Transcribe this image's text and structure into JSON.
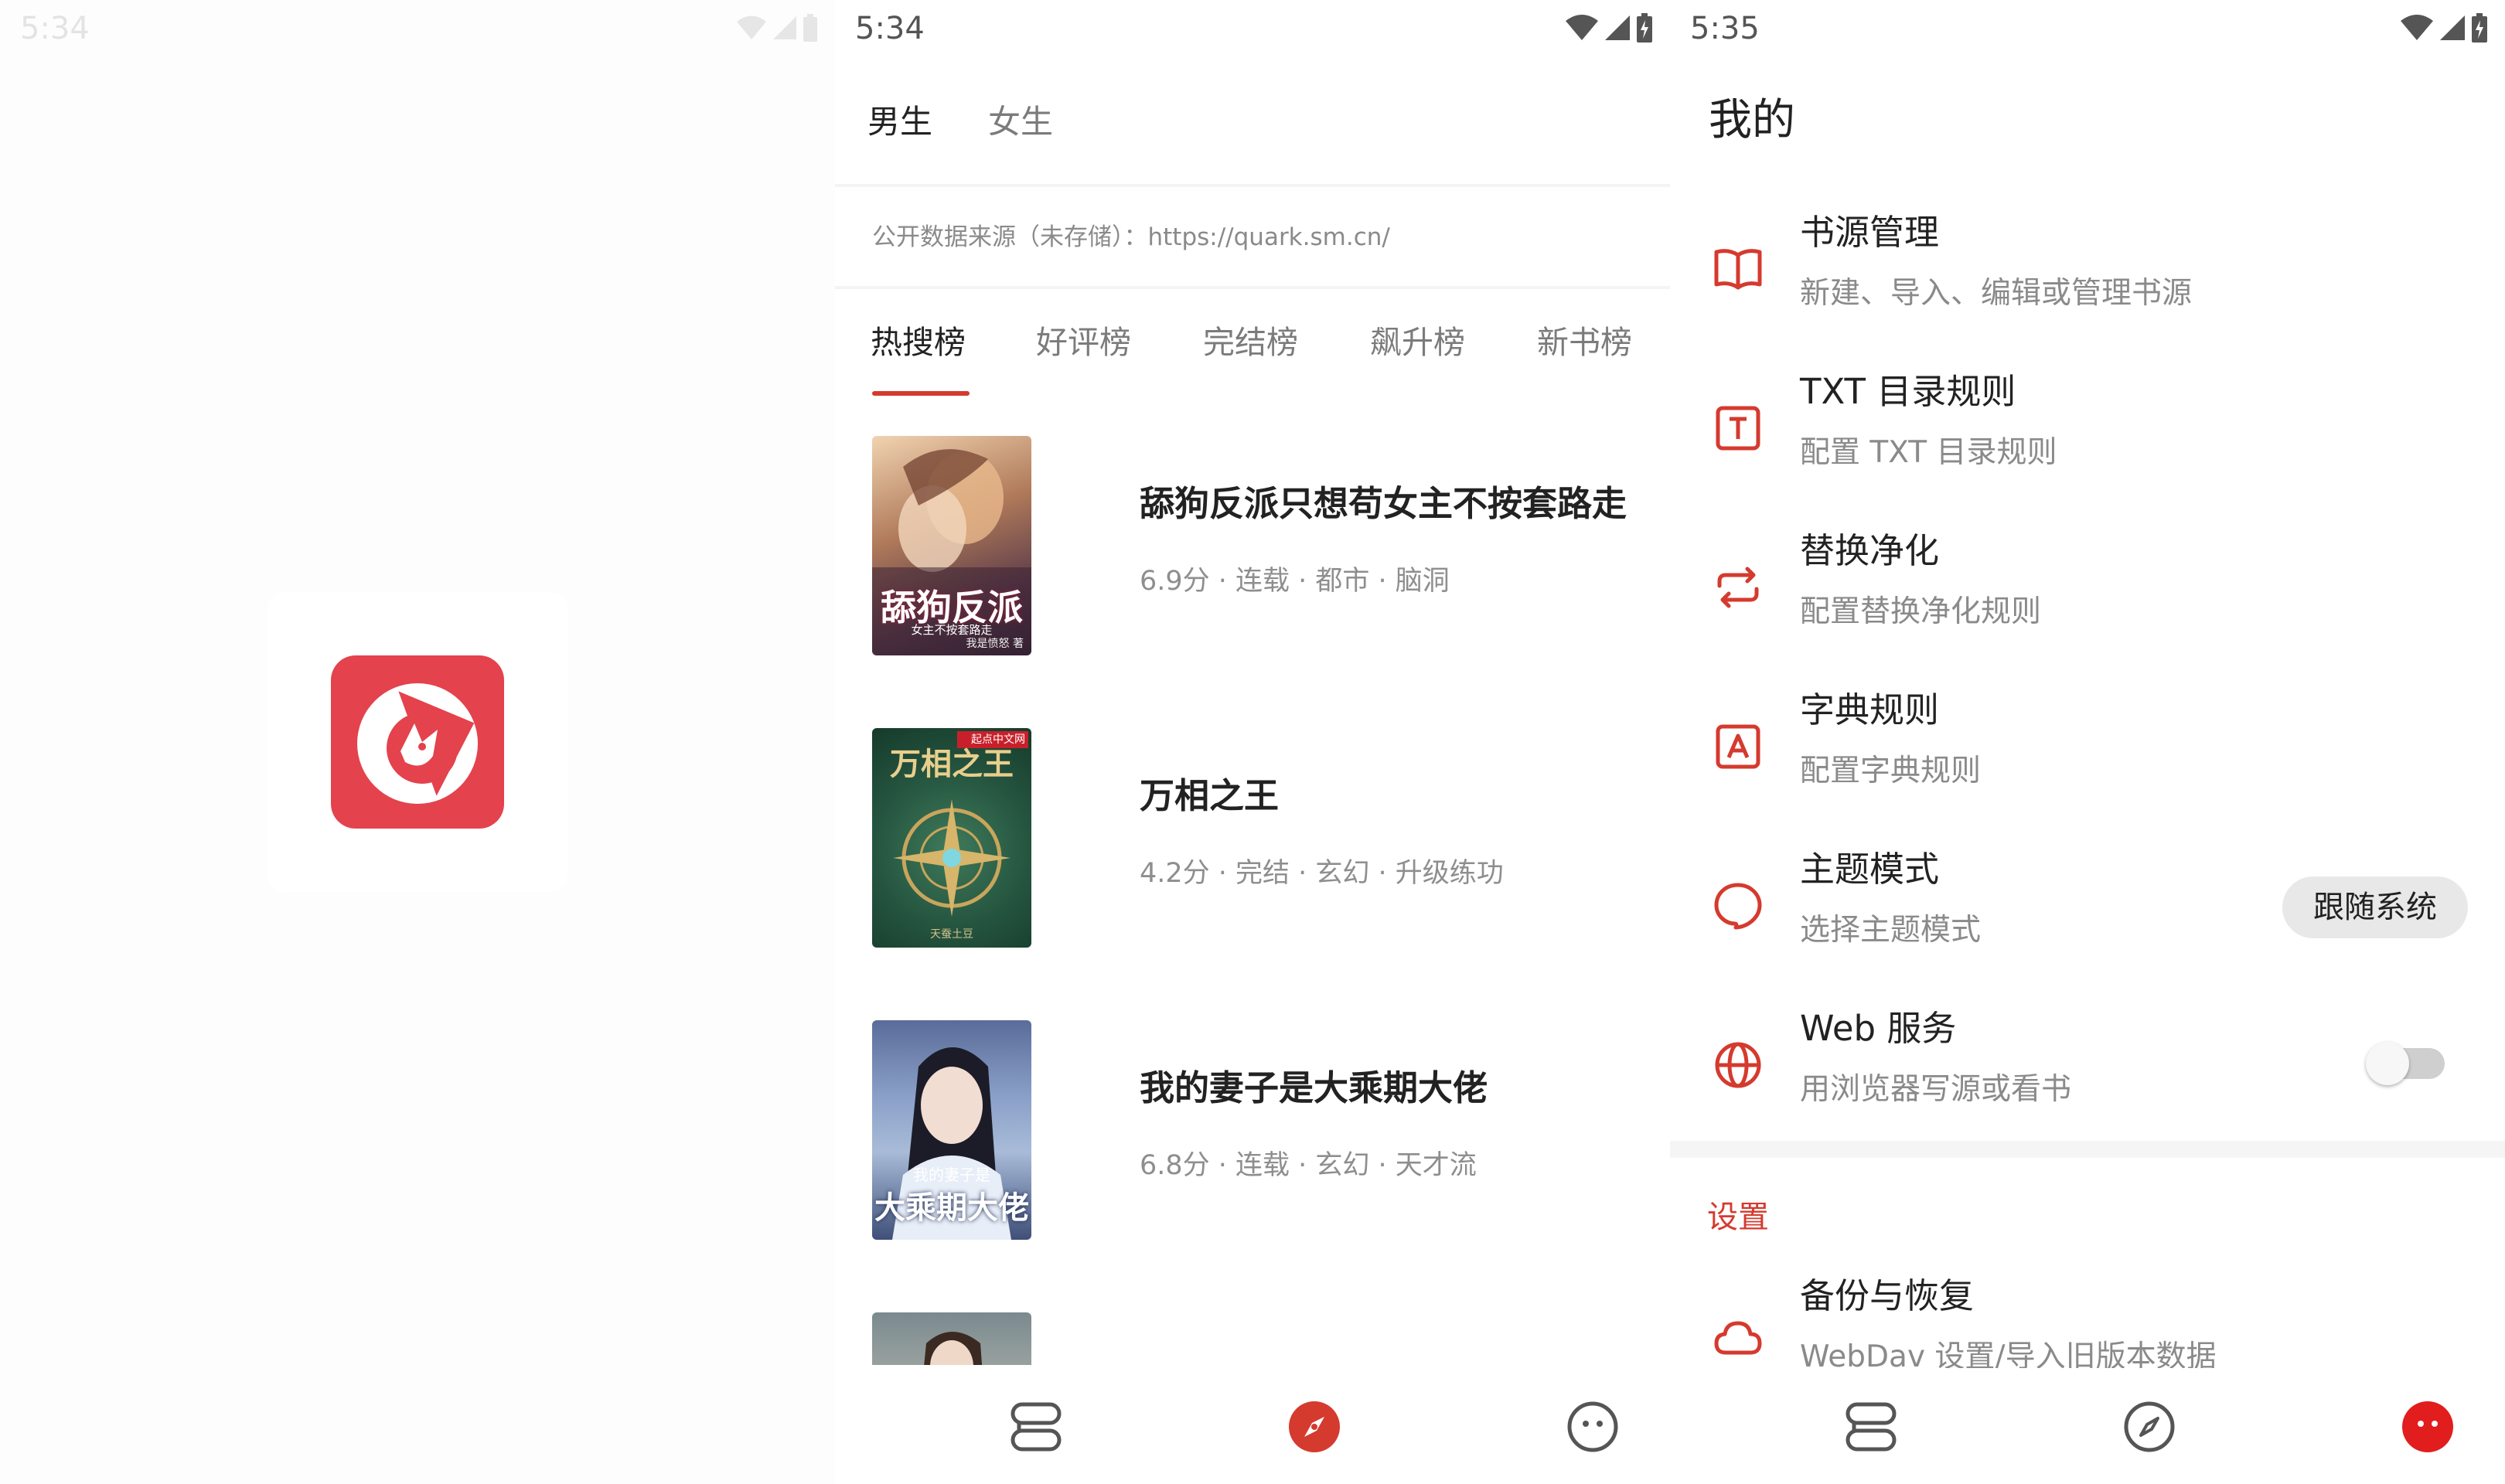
{
  "colors": {
    "accent": "#d53a2e",
    "logo": "#e4424d"
  },
  "splash": {
    "status_time": "5:34",
    "logo_icon": "fox-logo-icon"
  },
  "discover": {
    "status_time": "5:34",
    "gender_tabs": [
      "男生",
      "女生"
    ],
    "source_notice": "公开数据来源（未存储）：https://quark.sm.cn/",
    "rank_tabs": [
      "热搜榜",
      "好评榜",
      "完结榜",
      "飙升榜",
      "新书榜"
    ],
    "books": [
      {
        "title": "舔狗反派只想苟女主不按套路走",
        "meta": "6.9分 · 连载 · 都市 · 脑洞",
        "cover_text": "舔狗反派",
        "cover_sub": "女主不按套路走",
        "cover_author": "我是愤怒 著"
      },
      {
        "title": "万相之王",
        "meta": "4.2分 · 完结 · 玄幻 · 升级练功",
        "cover_text": "万相之王",
        "cover_badge": "起点中文网",
        "cover_author": "天蚕土豆"
      },
      {
        "title": "我的妻子是大乘期大佬",
        "meta": "6.8分 · 连载 · 玄幻 · 天才流",
        "cover_text": "大乘期大佬",
        "cover_sub": "我的妻子是"
      }
    ]
  },
  "mine": {
    "status_time": "5:35",
    "title": "我的",
    "items": [
      {
        "title": "书源管理",
        "subtitle": "新建、导入、编辑或管理书源",
        "icon": "book-open-icon"
      },
      {
        "title": "TXT 目录规则",
        "subtitle": "配置 TXT 目录规则",
        "icon": "txt-icon"
      },
      {
        "title": "替换净化",
        "subtitle": "配置替换净化规则",
        "icon": "replace-icon"
      },
      {
        "title": "字典规则",
        "subtitle": "配置字典规则",
        "icon": "dictionary-icon"
      },
      {
        "title": "主题模式",
        "subtitle": "选择主题模式",
        "icon": "theme-icon",
        "chip": "跟随系统"
      },
      {
        "title": "Web 服务",
        "subtitle": "用浏览器写源或看书",
        "icon": "globe-icon",
        "toggle": false
      }
    ],
    "section_settings": "设置",
    "backup": {
      "title": "备份与恢复",
      "subtitle": "WebDav 设置/导入旧版本数据",
      "icon": "cloud-icon"
    }
  },
  "bottom_nav": [
    "bookshelf-icon",
    "explore-icon",
    "profile-icon"
  ]
}
